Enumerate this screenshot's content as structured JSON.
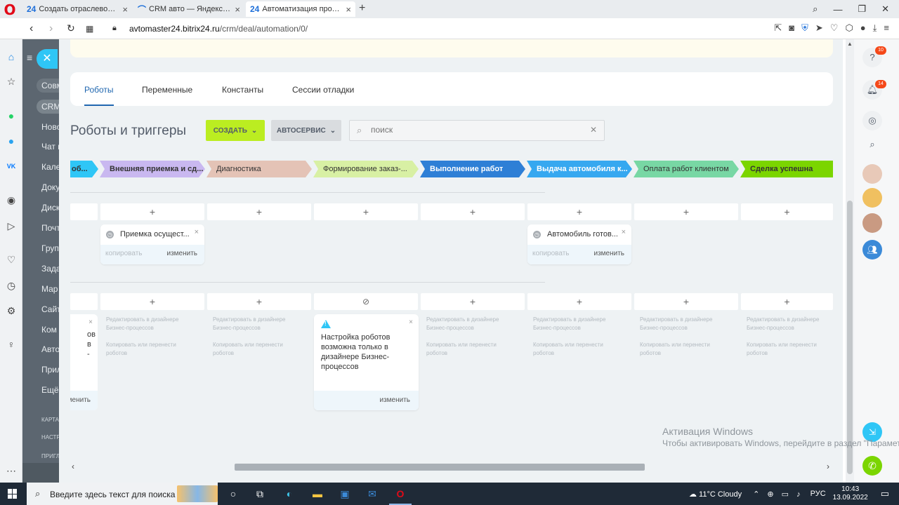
{
  "browser": {
    "tabs": [
      {
        "favicon": "24",
        "label": "Создать отраслевое реше",
        "active": false
      },
      {
        "favicon": "disk",
        "label": "CRM авто — Яндекс.Диск",
        "active": false
      },
      {
        "favicon": "24",
        "label": "Автоматизация продаж",
        "active": true
      }
    ],
    "url_host": "avtomaster24.bitrix24.ru",
    "url_path": "/crm/deal/automation/0/"
  },
  "left_menu": {
    "items": [
      "Совм",
      "CRM",
      "Ново",
      "Чат и",
      "Кале",
      "Доку",
      "Диск",
      "Почт",
      "Груп",
      "Зада",
      "Мар",
      "Сайт",
      "Ком",
      "Авто",
      "Прил",
      "Ещё"
    ],
    "small": [
      "КАРТА",
      "НАСТР",
      "ПРИГЛ"
    ]
  },
  "main_tabs": [
    "Роботы",
    "Переменные",
    "Константы",
    "Сессии отладки"
  ],
  "title": "Роботы и триггеры",
  "buttons": {
    "create": "СОЗДАТЬ",
    "category": "АВТОСЕРВИС"
  },
  "search": {
    "placeholder": "поиск"
  },
  "stages": [
    {
      "name": "об...",
      "color": "#2fc6f6",
      "style": "dark"
    },
    {
      "name": "Внешняя приемка и сд...",
      "color": "#c9b8f0",
      "style": "dark"
    },
    {
      "name": "Диагностика",
      "color": "#e4c3b6",
      "style": "dark"
    },
    {
      "name": "Формирование заказ-...",
      "color": "#d8f0a4",
      "style": "dark"
    },
    {
      "name": "Выполнение работ",
      "color": "#2e7fd6",
      "style": "white"
    },
    {
      "name": "Выдача автомобиля к...",
      "color": "#36a8f0",
      "style": "white"
    },
    {
      "name": "Оплата работ клиентом",
      "color": "#78d7a4",
      "style": "dark"
    },
    {
      "name": "Сделка успешна",
      "color": "#7bd500",
      "style": "white"
    }
  ],
  "robots": [
    {
      "title": "Приемка осущест...",
      "copy": "копировать",
      "edit": "изменить"
    },
    {
      "title": "Автомобиль готов...",
      "copy": "копировать",
      "edit": "изменить"
    }
  ],
  "hint": {
    "line1": "Редактировать в дизайнере",
    "line2": "Бизнес-процессов",
    "line3": "Копировать или перенести",
    "line4": "роботов"
  },
  "notice": {
    "text": "Настройка роботов возможна только в дизайнере Бизнес-процессов",
    "edit": "изменить"
  },
  "partial_card": {
    "text": "ов в -",
    "edit": "изменить"
  },
  "activation": {
    "title": "Активация Windows",
    "subtitle": "Чтобы активировать Windows, перейдите в раздел \"Параметры\"."
  },
  "right_panel": {
    "help_badge": "10",
    "notif_badge": "14"
  },
  "taskbar": {
    "search_placeholder": "Введите здесь текст для поиска",
    "weather": "11°C  Cloudy",
    "lang": "РУС",
    "time": "10:43",
    "date": "13.09.2022"
  },
  "colors": {
    "accent": "#2067b0",
    "create": "#bbed21",
    "close": "#2fc6f6"
  }
}
